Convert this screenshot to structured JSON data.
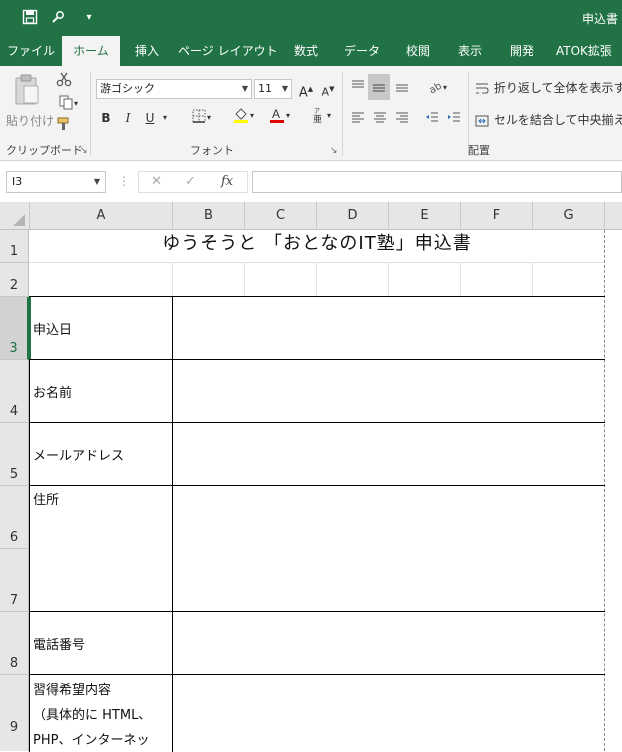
{
  "window": {
    "title": "申込書"
  },
  "tabs": [
    "ファイル",
    "ホーム",
    "挿入",
    "ページ レイアウト",
    "数式",
    "データ",
    "校閲",
    "表示",
    "開発",
    "ATOK拡張"
  ],
  "ribbon": {
    "clipboard": {
      "paste_label": "貼り付け",
      "group_label": "クリップボード"
    },
    "font": {
      "font_name": "游ゴシック",
      "font_size": "11",
      "bold": "B",
      "italic": "I",
      "underline": "U",
      "group_label": "フォント"
    },
    "alignment": {
      "wrap_text": "折り返して全体を表示する",
      "merge_center": "セルを結合して中央揃え",
      "group_label": "配置"
    },
    "colors": {
      "highlight": "#ffff00",
      "font_color": "#e00000",
      "accent": "#217346"
    }
  },
  "formula_bar": {
    "name_box": "I3",
    "fx": "fx",
    "value": ""
  },
  "grid": {
    "columns": [
      "A",
      "B",
      "C",
      "D",
      "E",
      "F",
      "G"
    ],
    "rows": [
      "1",
      "2",
      "3",
      "4",
      "5",
      "6",
      "7",
      "8",
      "9"
    ],
    "selected_cell": "I3"
  },
  "sheet": {
    "title": "ゆうそうと 「おとなのIT塾」申込書",
    "fields": {
      "date": "申込日",
      "name": "お名前",
      "email": "メールアドレス",
      "address": "住所",
      "phone": "電話番号",
      "course_line1": "習得希望内容",
      "course_line2": "（具体的に HTML、",
      "course_line3": "PHP、インターネッ"
    }
  }
}
